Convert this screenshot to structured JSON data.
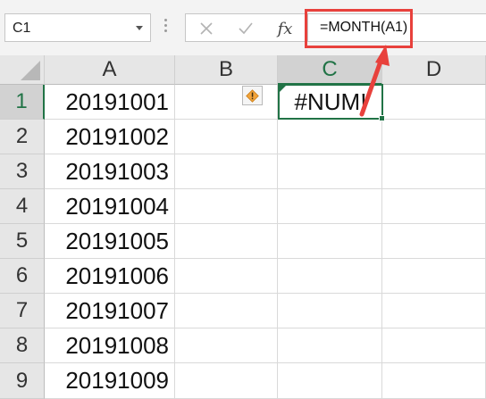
{
  "formula_bar": {
    "name_box": "C1",
    "formula": "=MONTH(A1)",
    "fx_label": "fx",
    "icons": [
      "chevron-down-icon",
      "grip-icon",
      "cancel-x-icon",
      "confirm-check-icon",
      "insert-function-icon"
    ]
  },
  "sheet": {
    "columns": [
      "A",
      "B",
      "C",
      "D"
    ],
    "selected_column": "C",
    "rows": [
      {
        "row": "1",
        "A": "20191001",
        "C": "#NUM!"
      },
      {
        "row": "2",
        "A": "20191002"
      },
      {
        "row": "3",
        "A": "20191003"
      },
      {
        "row": "4",
        "A": "20191004"
      },
      {
        "row": "5",
        "A": "20191005"
      },
      {
        "row": "6",
        "A": "20191006"
      },
      {
        "row": "7",
        "A": "20191007"
      },
      {
        "row": "8",
        "A": "20191008"
      },
      {
        "row": "9",
        "A": "20191009"
      }
    ],
    "active_cell": "C1",
    "error_indicator_icon": "warning-diamond-icon"
  },
  "colors": {
    "annotation_red": "#e8413c",
    "excel_green": "#217346",
    "warning_orange": "#f2a33a"
  }
}
